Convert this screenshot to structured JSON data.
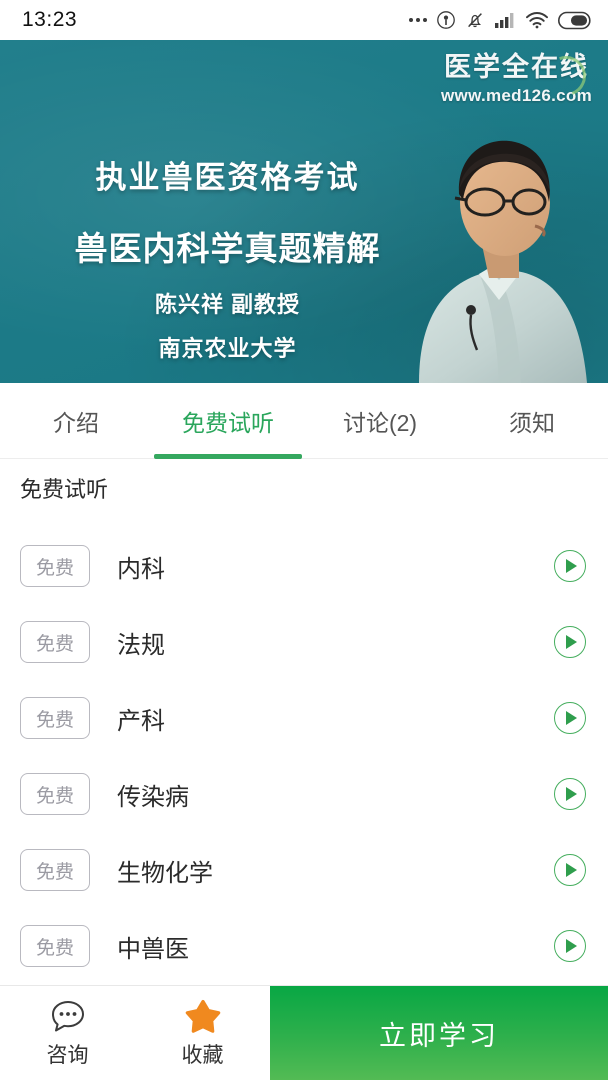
{
  "statusbar": {
    "time": "13:23",
    "icons": [
      "more-dots-icon",
      "cast-icon",
      "mute-bell-icon",
      "signal-icon",
      "wifi-icon",
      "battery-icon"
    ]
  },
  "banner": {
    "watermark_cn": "医学全在线",
    "watermark_url": "www.med126.com",
    "line1": "执业兽医资格考试",
    "line2": "兽医内科学真题精解",
    "line3": "陈兴祥  副教授",
    "line4": "南京农业大学",
    "bg_color": "#1d7b88",
    "lecturer": "lecturer-photo"
  },
  "tabs": [
    {
      "label": "介绍",
      "active": false
    },
    {
      "label": "免费试听",
      "active": true
    },
    {
      "label": "讨论(2)",
      "active": false
    },
    {
      "label": "须知",
      "active": false
    }
  ],
  "section": {
    "title": "免费试听"
  },
  "lessons": [
    {
      "badge": "免费",
      "title": "内科"
    },
    {
      "badge": "免费",
      "title": "法规"
    },
    {
      "badge": "免费",
      "title": "产科"
    },
    {
      "badge": "免费",
      "title": "传染病"
    },
    {
      "badge": "免费",
      "title": "生物化学"
    },
    {
      "badge": "免费",
      "title": "中兽医"
    }
  ],
  "bottombar": {
    "consult_label": "咨询",
    "favorite_label": "收藏",
    "cta_label": "立即学习",
    "accent_green": "#2fb04c",
    "star_orange": "#f0891f"
  }
}
